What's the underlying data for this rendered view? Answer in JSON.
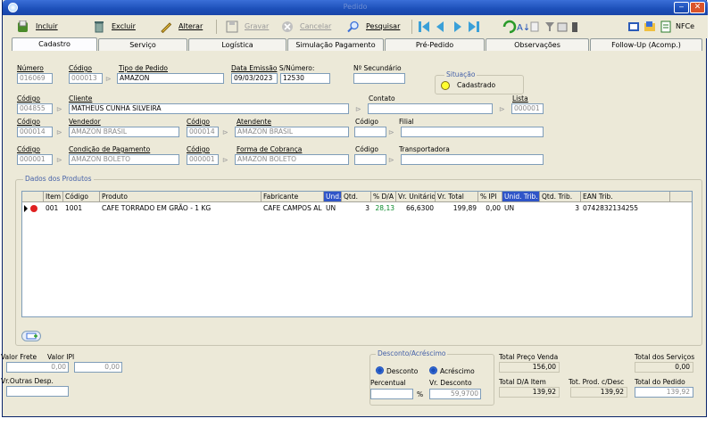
{
  "window": {
    "title": "Pedido"
  },
  "toolbar": {
    "incluir": "Incluir",
    "excluir": "Excluir",
    "alterar": "Alterar",
    "gravar": "Gravar",
    "cancelar": "Cancelar",
    "pesquisar": "Pesquisar",
    "nfce": "NFCe"
  },
  "tabs": [
    "Cadastro",
    "Serviço",
    "Logística",
    "Simulação Pagamento",
    "Pré-Pedido",
    "Observações",
    "Follow-Up (Acomp.)"
  ],
  "header": {
    "numero_label": "Número",
    "numero": "016069",
    "codigo_label": "Código",
    "codigo_tipo": "000013",
    "tipo_label": "Tipo de Pedido",
    "tipo": "AMAZON",
    "data_label": "Data Emissão",
    "data": "09/03/2023",
    "snum_label": "S/Número:",
    "snum": "12530",
    "nsec_label": "Nº Secundário",
    "nsec": ""
  },
  "situacao": {
    "legend": "Situação",
    "status": "Cadastrado"
  },
  "cliente": {
    "codigo_label": "Código",
    "codigo": "004855",
    "label": "Cliente",
    "nome": "MATHEUS CUNHA SILVEIRA",
    "contato_label": "Contato",
    "contato": "",
    "lista_label": "Lista",
    "lista": "000001"
  },
  "vendedor": {
    "codigo_label": "Código",
    "codigo": "000014",
    "label": "Vendedor",
    "nome": "AMAZON BRASIL",
    "codigo2_label": "Código",
    "codigo2": "000014",
    "atendente_label": "Atendente",
    "atendente": "AMAZON BRASIL",
    "codigo3_label": "Código",
    "filial_label": "Filial"
  },
  "pagamento": {
    "codigo_label": "Código",
    "codigo": "000001",
    "label": "Condição de Pagamento",
    "nome": "AMAZON BOLETO",
    "codigo2_label": "Código",
    "codigo2": "000001",
    "cobranca_label": "Forma de Cobrança",
    "cobranca": "AMAZON BOLETO",
    "codigo3_label": "Código",
    "transp_label": "Transportadora"
  },
  "produtos": {
    "legend": "Dados dos Produtos",
    "columns": [
      "Item",
      "Código",
      "Produto",
      "Fabricante",
      "Und.",
      "Qtd.",
      "% D/A",
      "Vr. Unitário",
      "Vr. Total",
      "% IPI",
      "Unid. Trib.",
      "Qtd. Trib.",
      "EAN Trib."
    ],
    "rows": [
      [
        "001",
        "1001",
        "CAFE TORRADO EM GRÃO - 1 KG",
        "CAFE CAMPOS AL",
        "UN",
        "3",
        "28,13",
        "66,6300",
        "199,89",
        "0,00",
        "UN",
        "3",
        "0742832134255"
      ]
    ]
  },
  "totais": {
    "frete_label": "Valor Frete",
    "frete": "0,00",
    "ipi_label": "Valor IPI",
    "ipi": "0,00",
    "outras_label": "Vr.Outras Desp.",
    "outras": "",
    "desc_legend": "Desconto/Acréscimo",
    "desconto": "Desconto",
    "acrescimo": "Acréscimo",
    "perc_label": "Percentual",
    "perc": "",
    "perc_sym": "%",
    "vdesc_label": "Vr. Desconto",
    "vdesc": "59,9700",
    "tpv_label": "Total Preço Venda",
    "tpv": "156,00",
    "tda_label": "Total D/A Item",
    "tda": "139,92",
    "tpd_label": "Tot. Prod. c/Desc",
    "tpd": "139,92",
    "ts_label": "Total dos Serviços",
    "ts": "0,00",
    "tp_label": "Total do Pedido",
    "tp": "139,92"
  },
  "colors": {
    "title": "#1c4fb8",
    "accent": "#2f55c8",
    "status_yellow": "#ffff30",
    "da_green": "#0a8a2a"
  }
}
